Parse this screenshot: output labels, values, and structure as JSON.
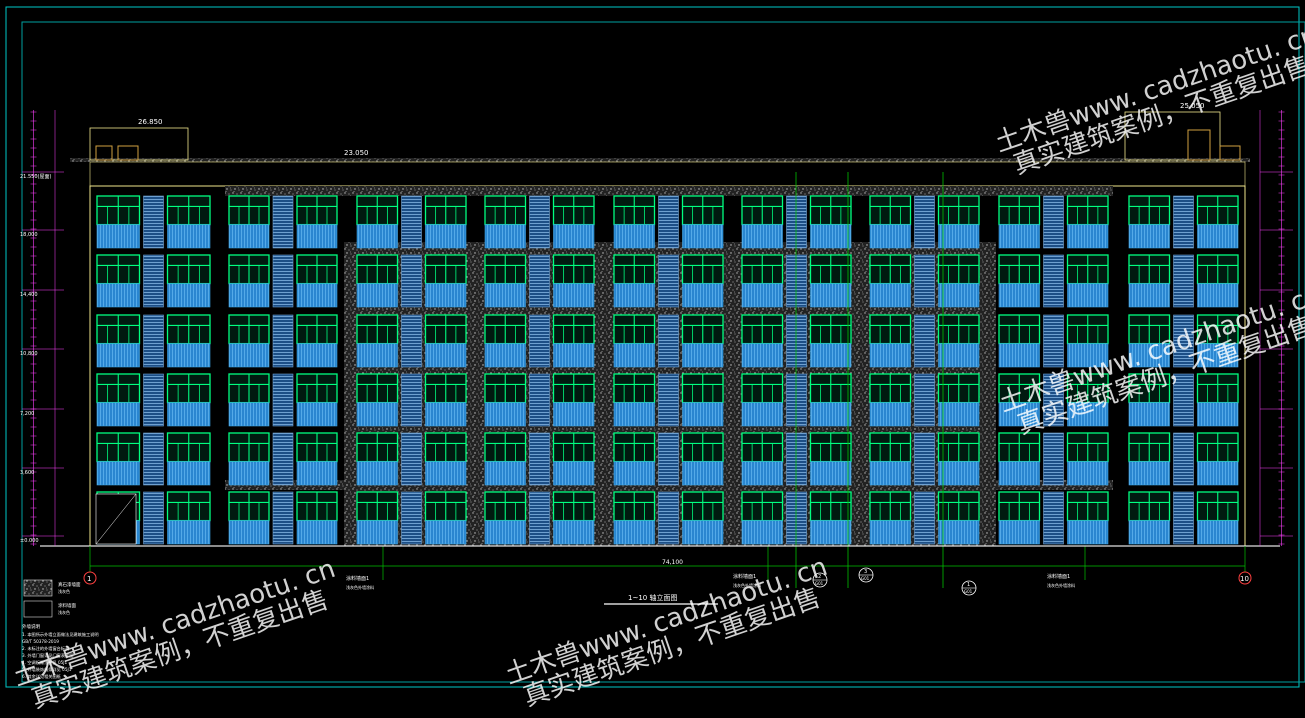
{
  "drawing": {
    "title": "1~10 轴立面图",
    "total_length": "74,100",
    "levels_left": [
      "21.550(屋面)",
      "18,000",
      "14,400",
      "10,800",
      "7,200",
      "3,600",
      "±0.000"
    ],
    "roof_top_left": "26.850",
    "roof_top_right": "25.050",
    "parapet_level": "23.050",
    "axis_labels": [
      "1",
      "10"
    ],
    "section_marks": [
      {
        "num": "2",
        "sheet": "G01"
      },
      {
        "num": "3",
        "sheet": "G01"
      },
      {
        "num": "1",
        "sheet": "G01"
      }
    ],
    "callouts": [
      "涂料墙面1",
      "涂料墙面1",
      "涂料墙面1"
    ],
    "callout_subs": [
      "浅灰色外墙涂料",
      "浅灰色外墙涂料",
      "浅灰色外墙涂料"
    ],
    "legend": [
      {
        "label": "真石漆墙面",
        "sub": "浅灰色"
      },
      {
        "label": "涂料墙面",
        "sub": "浅灰色"
      }
    ],
    "notes_title": "外墙说明",
    "notes": [
      "1. 本图所示外墙立面做法见建筑施工说明",
      "GB/T 50378-2019",
      "2. 未标注的外墙窗台标高",
      "3. 外墙门窗详见门窗表详图",
      "4. 空调板做法参见 05J1",
      "5. 外墙装饰线条详见 05J1",
      "6. 其余详见相关图纸"
    ]
  },
  "watermarks": [
    {
      "line1": "土木兽www. cadzhaotu. cn",
      "line2": "真实建筑案例，不重复出售"
    },
    {
      "line1": "土木兽www. cadzhaotu. cn",
      "line2": "真实建筑案例，不重复出售"
    },
    {
      "line1": "土木兽www. cadzhaotu. cn",
      "line2": "真实建筑案例，不重复出售"
    },
    {
      "line1": "土木兽www. cadzhaotu. cn",
      "line2": "真实建筑案例，不重复出售"
    }
  ],
  "colors": {
    "frame": "#00c8c8",
    "window_frame": "#00ff80",
    "glass": "#3aa0e0",
    "louver": "#6ea0d0",
    "stucco": "#9a9a9a",
    "outline": "#f0e68c",
    "axis": "#00c000",
    "level_marker": "#ff40ff",
    "axis_circle": "#ff4040"
  }
}
